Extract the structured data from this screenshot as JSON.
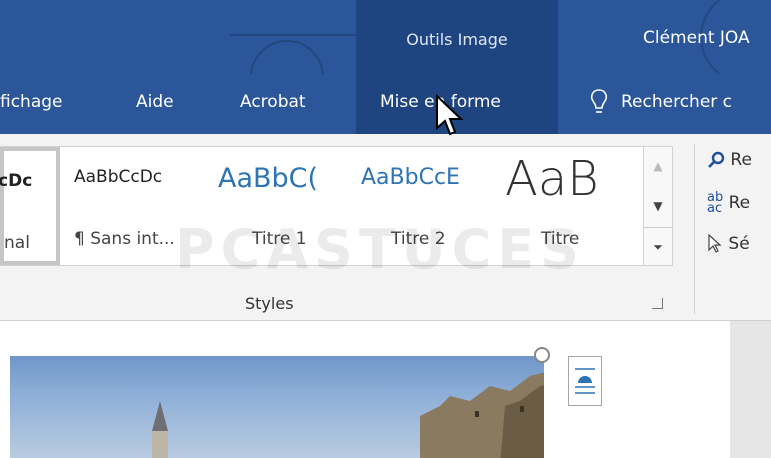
{
  "titlebar": {
    "context_label": "Outils Image",
    "user": "Clément JOA"
  },
  "tabs": [
    {
      "label": "fichage"
    },
    {
      "label": "Aide"
    },
    {
      "label": "Acrobat"
    },
    {
      "label": "Mise en forme",
      "active": true
    }
  ],
  "search": {
    "label": "Rechercher c"
  },
  "styles_gallery": {
    "items": [
      {
        "preview": "cDc",
        "name": "nal"
      },
      {
        "preview": "AaBbCcDc",
        "name": "¶ Sans int..."
      },
      {
        "preview": "AaBbC(",
        "name": "Titre 1"
      },
      {
        "preview": "AaBbCcE",
        "name": "Titre 2"
      },
      {
        "preview": "AaB",
        "name": "Titre"
      }
    ],
    "group_label": "Styles"
  },
  "right_group": {
    "items": [
      {
        "label": "Re",
        "icon": "search-icon"
      },
      {
        "label": "Re",
        "icon": "replace-icon"
      },
      {
        "label": "Sé",
        "icon": "select-cursor-icon"
      }
    ]
  },
  "watermark": "PCASTUCES",
  "colors": {
    "titlebar": "#2b579a",
    "context_tab": "#1f4580",
    "heading_blue": "#2e74b5"
  }
}
